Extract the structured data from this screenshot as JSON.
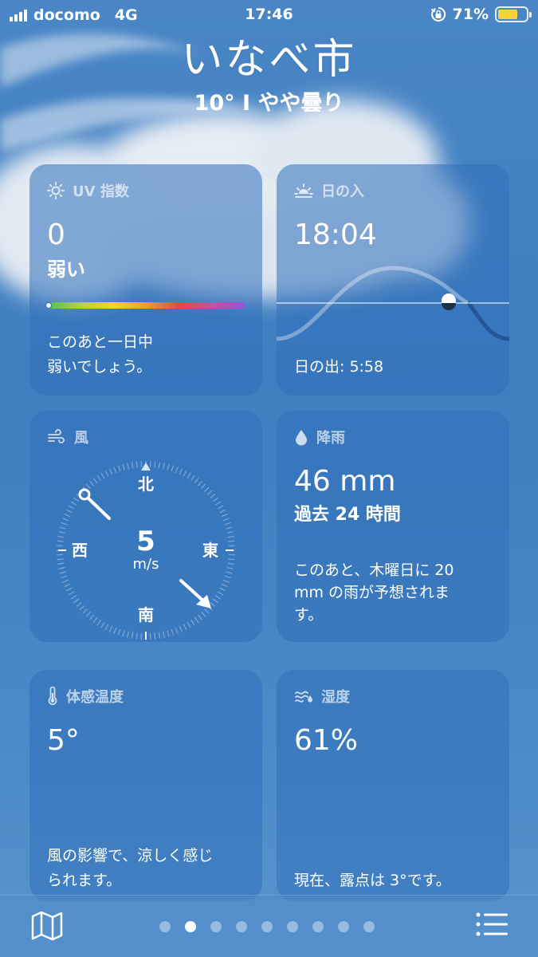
{
  "status": {
    "carrier": "docomo",
    "network": "4G",
    "time": "17:46",
    "battery_percent": "71%",
    "battery_level": 0.71
  },
  "header": {
    "city": "いなべ市",
    "summary": "10°  I  やや曇り"
  },
  "uv": {
    "title": "UV 指数",
    "value": "0",
    "level": "弱い",
    "level_fraction": 0.0,
    "desc_line1": "このあと一日中",
    "desc_line2": "弱いでしょう。"
  },
  "sunset": {
    "title": "日の入",
    "value": "18:04",
    "sunrise": "日の出: 5:58"
  },
  "wind": {
    "title": "風",
    "speed": "5",
    "unit": "m/s",
    "north": "北",
    "south": "南",
    "east": "東",
    "west": "西"
  },
  "rain": {
    "title": "降雨",
    "value": "46 mm",
    "period": "過去 24 時間",
    "desc_line1": "このあと、木曜日に 20",
    "desc_line2": "mm の雨が予想されま",
    "desc_line3": "す。"
  },
  "feels": {
    "title": "体感温度",
    "value": "5°",
    "desc_line1": "風の影響で、涼しく感じ",
    "desc_line2": "られます。"
  },
  "humidity": {
    "title": "湿度",
    "value": "61%",
    "desc": "現在、露点は 3°です。"
  },
  "pager": {
    "total": 9,
    "active_index": 1
  },
  "icons": {
    "uv": "sun-icon",
    "sunset": "sunset-icon",
    "wind": "wind-icon",
    "rain": "raindrop-icon",
    "feels": "thermometer-icon",
    "humidity": "humidity-icon",
    "map": "map-icon",
    "list": "list-icon"
  },
  "colors": {
    "battery": "#f5d33a",
    "sky": "#4a86c6"
  }
}
